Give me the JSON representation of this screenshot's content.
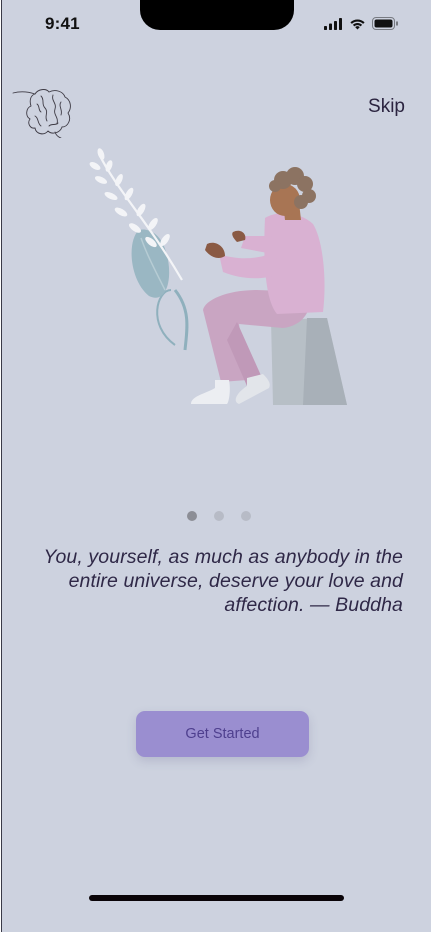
{
  "status_bar": {
    "time": "9:41",
    "icons": [
      "cellular-signal-icon",
      "wifi-icon",
      "battery-icon"
    ]
  },
  "header": {
    "logo": "brain-logo-icon",
    "skip_label": "Skip"
  },
  "illustration": "meditating-person-illustration",
  "pager": {
    "count": 3,
    "active_index": 0
  },
  "quote": {
    "text": "You, yourself, as much as anybody in the entire universe, deserve your love and affection. — Buddha"
  },
  "cta": {
    "label": "Get Started"
  },
  "colors": {
    "background": "#cdd2df",
    "button": "#9a8ed0",
    "button_text": "#4e3f8e",
    "text": "#2f2847"
  }
}
